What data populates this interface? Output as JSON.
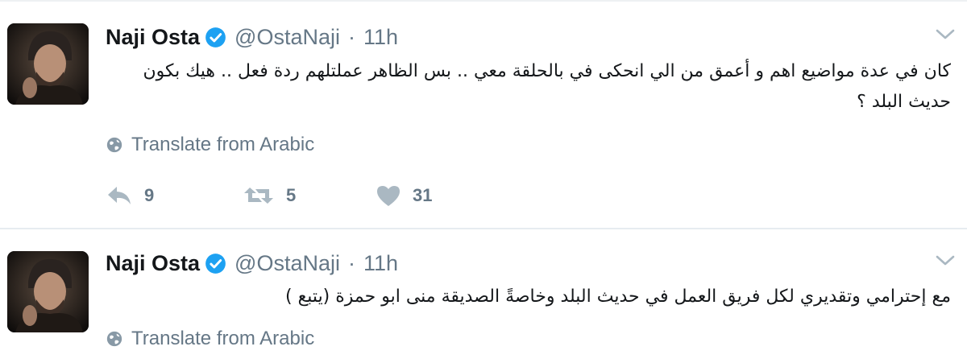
{
  "tweets": [
    {
      "author": {
        "name": "Naji Osta",
        "handle": "@OstaNaji",
        "verified": true
      },
      "separator": "·",
      "time": "11h",
      "text": "كان في عدة مواضيع اهم و أعمق من الي انحكى في بالحلقة معي .. بس الظاهر عملتلهم ردة فعل .. هيك بكون حديث البلد ؟",
      "translate_label": "Translate from Arabic",
      "actions": {
        "replies": "9",
        "retweets": "5",
        "likes": "31"
      }
    },
    {
      "author": {
        "name": "Naji Osta",
        "handle": "@OstaNaji",
        "verified": true
      },
      "separator": "·",
      "time": "11h",
      "text": "مع إحترامي وتقديري لكل فريق العمل في حديث البلد وخاصةً الصديقة منى ابو حمزة (يتبع )",
      "translate_label": "Translate from Arabic"
    }
  ],
  "colors": {
    "verified_blue": "#1da1f2",
    "meta_gray": "#657786",
    "icon_gray": "#aab8c2",
    "divider": "#e6ecf0"
  },
  "icons": [
    "verified-badge-icon",
    "chevron-down-icon",
    "globe-icon",
    "reply-icon",
    "retweet-icon",
    "heart-icon"
  ]
}
